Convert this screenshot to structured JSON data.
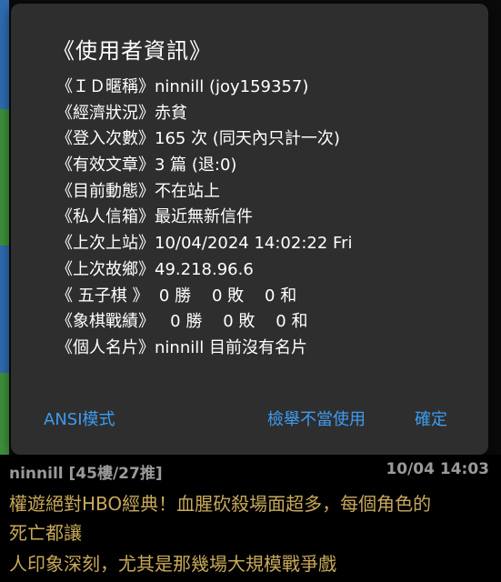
{
  "dialog": {
    "title": "《使用者資訊》",
    "rows": [
      {
        "label": "《ＩＤ暱稱》",
        "value": "ninnill (joy159357)"
      },
      {
        "label": "《經濟狀況》",
        "value": "赤貧"
      },
      {
        "label": "《登入次數》",
        "value": "165 次 (同天內只計一次)"
      },
      {
        "label": "《有效文章》",
        "value": "3 篇 (退:0)"
      },
      {
        "label": "《目前動態》",
        "value": "不在站上"
      },
      {
        "label": "《私人信箱》",
        "value": "最近無新信件"
      },
      {
        "label": "《上次上站》",
        "value": "10/04/2024 14:02:22 Fri"
      },
      {
        "label": "《上次故鄉》",
        "value": "49.218.96.6"
      },
      {
        "label": "《 五子棋 》",
        "value": "  0 勝    0 敗    0 和"
      },
      {
        "label": "《象棋戰績》",
        "value": "   0 勝    0 敗    0 和"
      },
      {
        "label": "《個人名片》",
        "value": "ninnill 目前沒有名片"
      }
    ],
    "actions": {
      "ansi": "ANSI模式",
      "report": "檢舉不當使用",
      "confirm": "確定"
    }
  },
  "post": {
    "author": "ninnill [45樓/27推]",
    "time": "10/04 14:03",
    "lines": [
      "權遊絕對HBO經典！血腥砍殺場面超多，每個角色的",
      "死亡都讓",
      "人印象深刻，尤其是那幾場大規模戰爭戲"
    ]
  },
  "colors": {
    "dialog_bg": "#2e2e2e",
    "accent": "#3d9cf0",
    "post_text": "#c9a95a",
    "side_strips": [
      "#2e6bb0",
      "#3f8f3a",
      "#2e6bb0",
      "#3f8f3a"
    ]
  }
}
